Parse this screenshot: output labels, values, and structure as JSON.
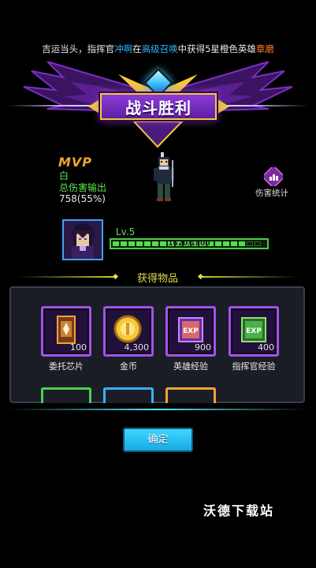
{
  "ticker": {
    "p1": "吉运当头，指挥官",
    "player": "冲啊",
    "p2": "在",
    "source": "高级召唤",
    "p3": "中获得5星橙色英雄",
    "hero": "章磨"
  },
  "banner": {
    "title": "战斗胜利"
  },
  "mvp": {
    "badge": "MVP",
    "name": "白",
    "stat_label": "总伤害输出",
    "stat_value": "758(55%)"
  },
  "damage_stats": {
    "label": "伤害统计",
    "icon": "bar-chart-icon"
  },
  "hero_progress": {
    "level": "Lv.5",
    "xp_text": "1620/1800",
    "xp_fraction": 0.9
  },
  "rewards": {
    "section_title": "获得物品",
    "items": [
      {
        "name": "委托芯片",
        "qty": "100",
        "icon": "chip-card-icon"
      },
      {
        "name": "金币",
        "qty": "4,300",
        "icon": "gold-coin-icon"
      },
      {
        "name": "英雄经验",
        "qty": "900",
        "icon": "hero-exp-book-icon"
      },
      {
        "name": "指挥官经验",
        "qty": "400",
        "icon": "commander-exp-book-icon"
      }
    ]
  },
  "confirm": {
    "label": "确定"
  },
  "watermark": "沃德下载站",
  "colors": {
    "accent_green": "#5fe34e",
    "accent_purple": "#a650f0",
    "accent_cyan": "#3fd8ff",
    "gold": "#f4c93a"
  }
}
